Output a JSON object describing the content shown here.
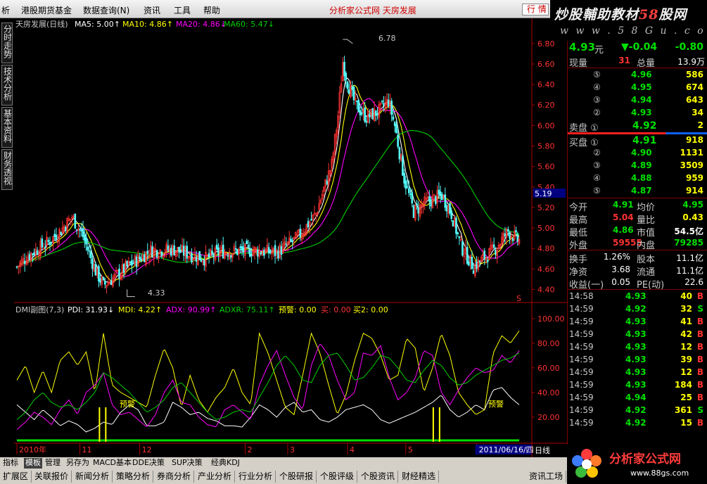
{
  "menu": {
    "items": [
      "析",
      "港股期货基金",
      "数据查询(N)",
      "资讯",
      "工具",
      "帮助"
    ],
    "title": "分析家公式网 天房发展",
    "trade_box": "行 情"
  },
  "banner": {
    "text_main": "炒股輔助教材",
    "text_num": "58",
    "text_tail": "股网",
    "url": "w w w . 5 8 G u . c o m"
  },
  "side_tabs": [
    "分时走势",
    "技术分析",
    "基本资料",
    "财务透视"
  ],
  "colors": {
    "up": "#ff3232",
    "down": "#54ffff",
    "ma5": "#ffffff",
    "ma10": "#ffff00",
    "ma20": "#ff00ff",
    "ma60": "#00d000",
    "pdi": "#ffffff",
    "mdi": "#ffff00",
    "adx": "#ff00ff",
    "adxr": "#00d000",
    "axis": "#b00000"
  },
  "main_header": {
    "name": "天房发展(日线)",
    "ma5": "MA5: 5.00↑",
    "ma10": "MA10: 4.86↑",
    "ma20": "MA20: 4.86↓",
    "ma60": "MA60: 5.47↓"
  },
  "indicator_header": {
    "name": "DMI副图(7,3)",
    "pdi": "PDI: 31.93↓",
    "mdi": "MDI: 4.22↑",
    "adx": "ADX: 90.99↑",
    "adxr": "ADXR: 75.11↑",
    "warn": "预警: 0.00",
    "buy": "买: 0.00",
    "buy2": "买2: 0.00"
  },
  "annotations": {
    "high": "6.78",
    "low": "4.33",
    "warn": "预警",
    "current_price": "5.19",
    "marker": "S"
  },
  "chart_data": [
    {
      "type": "candlestick",
      "title": "天房发展(日线)",
      "ylim": [
        4.3,
        6.95
      ],
      "y_ticks": [
        "6.80",
        "6.60",
        "6.40",
        "6.20",
        "6.00",
        "5.80",
        "5.60",
        "5.40",
        "5.20",
        "5.00",
        "4.80",
        "4.60",
        "4.40"
      ],
      "price_path": [
        [
          0,
          4.62
        ],
        [
          8,
          4.74
        ],
        [
          20,
          4.86
        ],
        [
          28,
          4.98
        ],
        [
          35,
          5.11
        ],
        [
          42,
          4.92
        ],
        [
          50,
          4.58
        ],
        [
          55,
          4.44
        ],
        [
          62,
          4.52
        ],
        [
          70,
          4.62
        ],
        [
          85,
          4.78
        ],
        [
          100,
          4.79
        ],
        [
          110,
          4.74
        ],
        [
          120,
          4.7
        ],
        [
          130,
          4.77
        ],
        [
          150,
          4.78
        ],
        [
          165,
          4.76
        ],
        [
          178,
          4.9
        ],
        [
          190,
          5.14
        ],
        [
          200,
          5.62
        ],
        [
          204,
          6.1
        ],
        [
          207,
          6.62
        ],
        [
          210,
          6.42
        ],
        [
          215,
          6.2
        ],
        [
          222,
          6.08
        ],
        [
          230,
          6.14
        ],
        [
          236,
          6.24
        ],
        [
          240,
          6.0
        ],
        [
          246,
          5.48
        ],
        [
          252,
          5.16
        ],
        [
          260,
          5.25
        ],
        [
          270,
          5.32
        ],
        [
          276,
          5.14
        ],
        [
          282,
          4.82
        ],
        [
          290,
          4.62
        ],
        [
          296,
          4.7
        ],
        [
          304,
          4.8
        ],
        [
          312,
          4.97
        ],
        [
          318,
          4.88
        ]
      ],
      "series": [
        {
          "name": "MA5",
          "last": 5.0
        },
        {
          "name": "MA10",
          "last": 4.86
        },
        {
          "name": "MA20",
          "last": 4.86
        },
        {
          "name": "MA60",
          "last": 5.47
        }
      ],
      "x_labels": [
        "2010年",
        "11",
        "12",
        "2",
        "3",
        "4",
        "5",
        "2011/06/16/四"
      ],
      "x_label_days": [
        0,
        40,
        78,
        145,
        172,
        210,
        247,
        292
      ],
      "annotations": {
        "high": 6.78,
        "low": 4.33,
        "last_close": 5.19
      }
    },
    {
      "type": "line",
      "title": "DMI副图(7,3)",
      "ylim": [
        0,
        105
      ],
      "y_ticks": [
        "100.00",
        "80.00",
        "60.00",
        "40.00",
        "20.00"
      ],
      "series": [
        {
          "name": "PDI",
          "values": [
            30,
            24,
            18,
            26,
            20,
            13,
            17,
            14,
            8,
            11,
            16,
            14,
            24,
            30,
            26,
            13,
            13,
            16,
            32,
            28,
            22,
            24,
            19,
            17,
            13,
            13,
            12,
            20,
            30,
            26,
            20,
            28,
            32,
            24,
            26,
            18,
            16,
            20,
            26,
            28,
            30,
            26,
            18,
            15,
            18,
            21,
            24,
            28,
            32,
            38,
            26,
            20,
            24,
            30,
            26,
            42,
            44,
            36,
            30
          ]
        },
        {
          "name": "MDI",
          "values": [
            50,
            62,
            40,
            58,
            40,
            66,
            73,
            62,
            73,
            40,
            88,
            46,
            40,
            36,
            32,
            28,
            54,
            76,
            60,
            28,
            54,
            34,
            24,
            36,
            44,
            60,
            40,
            30,
            88,
            72,
            50,
            28,
            22,
            54,
            88,
            72,
            46,
            22,
            38,
            66,
            88,
            84,
            70,
            50,
            54,
            84,
            76,
            40,
            60,
            88,
            70,
            40,
            30,
            22,
            26,
            72,
            86,
            80,
            90
          ]
        },
        {
          "name": "ADX",
          "values": [
            10,
            16,
            24,
            20,
            14,
            26,
            34,
            22,
            40,
            46,
            56,
            30,
            22,
            24,
            18,
            12,
            22,
            40,
            50,
            32,
            30,
            20,
            14,
            12,
            26,
            30,
            24,
            18,
            46,
            62,
            74,
            54,
            36,
            26,
            62,
            80,
            70,
            50,
            34,
            40,
            72,
            70,
            78,
            52,
            34,
            40,
            52,
            74,
            70,
            40,
            30,
            42,
            52,
            60,
            56,
            58,
            70,
            64,
            74
          ]
        },
        {
          "name": "ADXR",
          "values": [
            18,
            24,
            34,
            40,
            32,
            28,
            30,
            26,
            32,
            40,
            56,
            52,
            46,
            40,
            32,
            24,
            28,
            34,
            44,
            48,
            40,
            32,
            24,
            18,
            20,
            24,
            26,
            24,
            36,
            48,
            62,
            70,
            62,
            50,
            48,
            62,
            70,
            72,
            62,
            50,
            52,
            60,
            70,
            68,
            60,
            50,
            48,
            58,
            66,
            62,
            52,
            46,
            48,
            54,
            58,
            62,
            66,
            68,
            72
          ]
        }
      ],
      "warn_days": [
        52,
        56,
        264,
        268
      ]
    }
  ],
  "quote": {
    "price": "4.93",
    "price_unit": "元",
    "change_arrow": "▼",
    "change": "-0.04",
    "change_pct": "-0.80",
    "volume_label": "现量",
    "volume": "31",
    "total_label": "总量",
    "total": "13.9万",
    "sells": [
      {
        "label": "⑤",
        "price": "4.96",
        "vol": "586"
      },
      {
        "label": "④",
        "price": "4.95",
        "vol": "674"
      },
      {
        "label": "③",
        "price": "4.94",
        "vol": "643"
      },
      {
        "label": "②",
        "price": "4.93",
        "vol": "34"
      },
      {
        "label": "卖盘 ①",
        "price": "4.92",
        "vol": "2"
      }
    ],
    "buys": [
      {
        "label": "买盘 ①",
        "price": "4.91",
        "vol": "918"
      },
      {
        "label": "②",
        "price": "4.90",
        "vol": "1131"
      },
      {
        "label": "③",
        "price": "4.89",
        "vol": "3509"
      },
      {
        "label": "④",
        "price": "4.88",
        "vol": "959"
      },
      {
        "label": "⑤",
        "price": "4.87",
        "vol": "914"
      }
    ],
    "stats": [
      {
        "l1": "今开",
        "v1": "4.91",
        "c1": "#00e000",
        "l2": "均价",
        "v2": "4.95",
        "c2": "#00e000"
      },
      {
        "l1": "最高",
        "v1": "5.04",
        "c1": "#ff3232",
        "l2": "量比",
        "v2": "0.43",
        "c2": "#ffff00"
      },
      {
        "l1": "最低",
        "v1": "4.86",
        "c1": "#00e000",
        "l2": "市值",
        "v2": "54.5亿",
        "c2": "#ffffff"
      },
      {
        "l1": "外盘",
        "v1": "59555",
        "c1": "#ff3232",
        "l2": "内盘",
        "v2": "79285",
        "c2": "#00e000"
      }
    ],
    "stats2": [
      {
        "l1": "换手",
        "v1": "1.26%",
        "l2": "股本",
        "v2": "11.1亿"
      },
      {
        "l1": "净资",
        "v1": "3.68",
        "l2": "流通",
        "v2": "11.1亿"
      },
      {
        "l1": "收益(一)",
        "v1": "0.05",
        "l2": "PE(动)",
        "v2": "22.6"
      }
    ],
    "ticks": [
      {
        "time": "14:58",
        "price": "4.93",
        "vol": "40",
        "side": "B"
      },
      {
        "time": "14:59",
        "price": "4.92",
        "vol": "32",
        "side": "S"
      },
      {
        "time": "14:59",
        "price": "4.93",
        "vol": "41",
        "side": "B"
      },
      {
        "time": "14:59",
        "price": "4.93",
        "vol": "42",
        "side": "B"
      },
      {
        "time": "14:59",
        "price": "4.93",
        "vol": "12",
        "side": "B"
      },
      {
        "time": "14:59",
        "price": "4.93",
        "vol": "39",
        "side": "B"
      },
      {
        "time": "14:59",
        "price": "4.93",
        "vol": "12",
        "side": "B"
      },
      {
        "time": "14:59",
        "price": "4.93",
        "vol": "184",
        "side": "B"
      },
      {
        "time": "14:59",
        "price": "4.94",
        "vol": "25",
        "side": "B"
      },
      {
        "time": "14:59",
        "price": "4.92",
        "vol": "361",
        "side": "S"
      },
      {
        "time": "14:59",
        "price": "4.92",
        "vol": "15",
        "side": "B"
      }
    ]
  },
  "period_label": "日线",
  "bottom_tabs1": [
    "指标",
    "模板",
    "管理",
    "另存为",
    "MACD基本",
    "DDE决策",
    "SUP决策",
    "经典KDJ"
  ],
  "bottom_tabs2": [
    "扩展区",
    "关联报价",
    "新闻分析",
    "策略分析",
    "券商分析",
    "产业分析",
    "行业分析",
    "个股研报",
    "个股评级",
    "个股资讯",
    "财经精选",
    "资讯工场"
  ],
  "logo": {
    "text": "分析家公式网",
    "url": "www.88gs.com"
  }
}
